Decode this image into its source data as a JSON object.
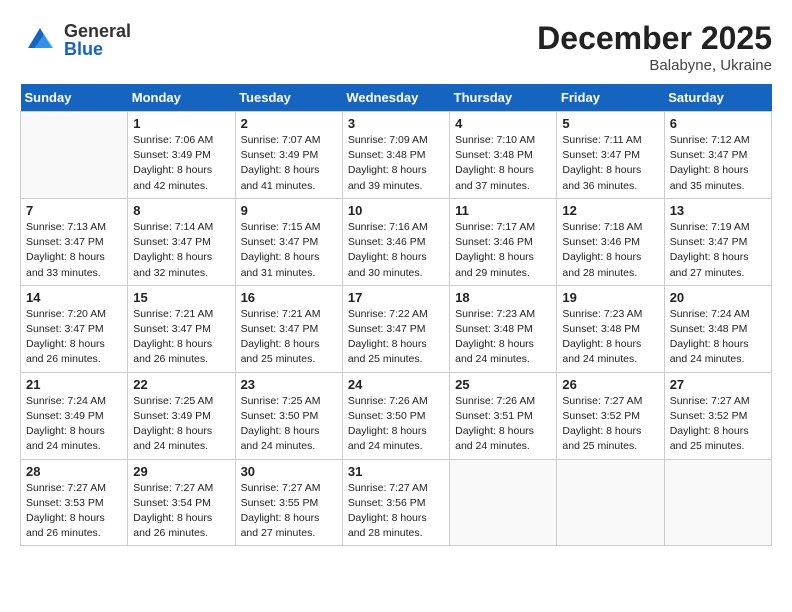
{
  "header": {
    "logo_general": "General",
    "logo_blue": "Blue",
    "month": "December 2025",
    "location": "Balabyne, Ukraine"
  },
  "weekdays": [
    "Sunday",
    "Monday",
    "Tuesday",
    "Wednesday",
    "Thursday",
    "Friday",
    "Saturday"
  ],
  "weeks": [
    [
      {
        "day": "",
        "info": ""
      },
      {
        "day": "1",
        "info": "Sunrise: 7:06 AM\nSunset: 3:49 PM\nDaylight: 8 hours\nand 42 minutes."
      },
      {
        "day": "2",
        "info": "Sunrise: 7:07 AM\nSunset: 3:49 PM\nDaylight: 8 hours\nand 41 minutes."
      },
      {
        "day": "3",
        "info": "Sunrise: 7:09 AM\nSunset: 3:48 PM\nDaylight: 8 hours\nand 39 minutes."
      },
      {
        "day": "4",
        "info": "Sunrise: 7:10 AM\nSunset: 3:48 PM\nDaylight: 8 hours\nand 37 minutes."
      },
      {
        "day": "5",
        "info": "Sunrise: 7:11 AM\nSunset: 3:47 PM\nDaylight: 8 hours\nand 36 minutes."
      },
      {
        "day": "6",
        "info": "Sunrise: 7:12 AM\nSunset: 3:47 PM\nDaylight: 8 hours\nand 35 minutes."
      }
    ],
    [
      {
        "day": "7",
        "info": "Sunrise: 7:13 AM\nSunset: 3:47 PM\nDaylight: 8 hours\nand 33 minutes."
      },
      {
        "day": "8",
        "info": "Sunrise: 7:14 AM\nSunset: 3:47 PM\nDaylight: 8 hours\nand 32 minutes."
      },
      {
        "day": "9",
        "info": "Sunrise: 7:15 AM\nSunset: 3:47 PM\nDaylight: 8 hours\nand 31 minutes."
      },
      {
        "day": "10",
        "info": "Sunrise: 7:16 AM\nSunset: 3:46 PM\nDaylight: 8 hours\nand 30 minutes."
      },
      {
        "day": "11",
        "info": "Sunrise: 7:17 AM\nSunset: 3:46 PM\nDaylight: 8 hours\nand 29 minutes."
      },
      {
        "day": "12",
        "info": "Sunrise: 7:18 AM\nSunset: 3:46 PM\nDaylight: 8 hours\nand 28 minutes."
      },
      {
        "day": "13",
        "info": "Sunrise: 7:19 AM\nSunset: 3:47 PM\nDaylight: 8 hours\nand 27 minutes."
      }
    ],
    [
      {
        "day": "14",
        "info": "Sunrise: 7:20 AM\nSunset: 3:47 PM\nDaylight: 8 hours\nand 26 minutes."
      },
      {
        "day": "15",
        "info": "Sunrise: 7:21 AM\nSunset: 3:47 PM\nDaylight: 8 hours\nand 26 minutes."
      },
      {
        "day": "16",
        "info": "Sunrise: 7:21 AM\nSunset: 3:47 PM\nDaylight: 8 hours\nand 25 minutes."
      },
      {
        "day": "17",
        "info": "Sunrise: 7:22 AM\nSunset: 3:47 PM\nDaylight: 8 hours\nand 25 minutes."
      },
      {
        "day": "18",
        "info": "Sunrise: 7:23 AM\nSunset: 3:48 PM\nDaylight: 8 hours\nand 24 minutes."
      },
      {
        "day": "19",
        "info": "Sunrise: 7:23 AM\nSunset: 3:48 PM\nDaylight: 8 hours\nand 24 minutes."
      },
      {
        "day": "20",
        "info": "Sunrise: 7:24 AM\nSunset: 3:48 PM\nDaylight: 8 hours\nand 24 minutes."
      }
    ],
    [
      {
        "day": "21",
        "info": "Sunrise: 7:24 AM\nSunset: 3:49 PM\nDaylight: 8 hours\nand 24 minutes."
      },
      {
        "day": "22",
        "info": "Sunrise: 7:25 AM\nSunset: 3:49 PM\nDaylight: 8 hours\nand 24 minutes."
      },
      {
        "day": "23",
        "info": "Sunrise: 7:25 AM\nSunset: 3:50 PM\nDaylight: 8 hours\nand 24 minutes."
      },
      {
        "day": "24",
        "info": "Sunrise: 7:26 AM\nSunset: 3:50 PM\nDaylight: 8 hours\nand 24 minutes."
      },
      {
        "day": "25",
        "info": "Sunrise: 7:26 AM\nSunset: 3:51 PM\nDaylight: 8 hours\nand 24 minutes."
      },
      {
        "day": "26",
        "info": "Sunrise: 7:27 AM\nSunset: 3:52 PM\nDaylight: 8 hours\nand 25 minutes."
      },
      {
        "day": "27",
        "info": "Sunrise: 7:27 AM\nSunset: 3:52 PM\nDaylight: 8 hours\nand 25 minutes."
      }
    ],
    [
      {
        "day": "28",
        "info": "Sunrise: 7:27 AM\nSunset: 3:53 PM\nDaylight: 8 hours\nand 26 minutes."
      },
      {
        "day": "29",
        "info": "Sunrise: 7:27 AM\nSunset: 3:54 PM\nDaylight: 8 hours\nand 26 minutes."
      },
      {
        "day": "30",
        "info": "Sunrise: 7:27 AM\nSunset: 3:55 PM\nDaylight: 8 hours\nand 27 minutes."
      },
      {
        "day": "31",
        "info": "Sunrise: 7:27 AM\nSunset: 3:56 PM\nDaylight: 8 hours\nand 28 minutes."
      },
      {
        "day": "",
        "info": ""
      },
      {
        "day": "",
        "info": ""
      },
      {
        "day": "",
        "info": ""
      }
    ]
  ]
}
